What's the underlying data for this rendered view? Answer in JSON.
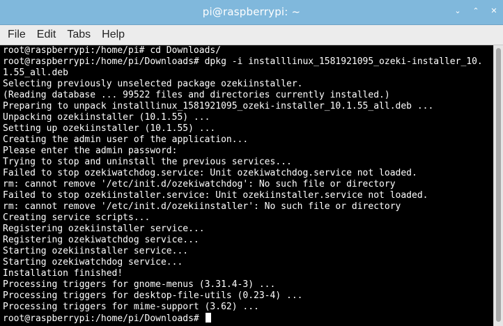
{
  "window": {
    "title": "pi@raspberrypi: ~",
    "minimize_glyph": "⌄",
    "maximize_glyph": "⌃",
    "close_glyph": "✕"
  },
  "menu": [
    "File",
    "Edit",
    "Tabs",
    "Help"
  ],
  "terminal": {
    "lines": [
      "root@raspberrypi:/home/pi# cd Downloads/",
      "root@raspberrypi:/home/pi/Downloads# dpkg -i installlinux_1581921095_ozeki-installer_10.",
      "1.55_all.deb",
      "Selecting previously unselected package ozekiinstaller.",
      "(Reading database ... 99522 files and directories currently installed.)",
      "Preparing to unpack installlinux_1581921095_ozeki-installer_10.1.55_all.deb ...",
      "Unpacking ozekiinstaller (10.1.55) ...",
      "Setting up ozekiinstaller (10.1.55) ...",
      "Creating the admin user of the application...",
      "Please enter the admin password:",
      "Trying to stop and uninstall the previous services...",
      "Failed to stop ozekiwatchdog.service: Unit ozekiwatchdog.service not loaded.",
      "rm: cannot remove '/etc/init.d/ozekiwatchdog': No such file or directory",
      "Failed to stop ozekiinstaller.service: Unit ozekiinstaller.service not loaded.",
      "rm: cannot remove '/etc/init.d/ozekiinstaller': No such file or directory",
      "Creating service scripts...",
      "Registering ozekiinstaller service...",
      "Registering ozekiwatchdog service...",
      "Starting ozekiinstaller service...",
      "Starting ozekiwatchdog service...",
      "Installation finished!",
      "Processing triggers for gnome-menus (3.31.4-3) ...",
      "Processing triggers for desktop-file-utils (0.23-4) ...",
      "Processing triggers for mime-support (3.62) ..."
    ],
    "prompt": "root@raspberrypi:/home/pi/Downloads# "
  },
  "colors": {
    "titlebar": "#80b8dc",
    "menubar": "#ececec",
    "terminal_bg": "#000000",
    "terminal_fg": "#ffffff"
  }
}
